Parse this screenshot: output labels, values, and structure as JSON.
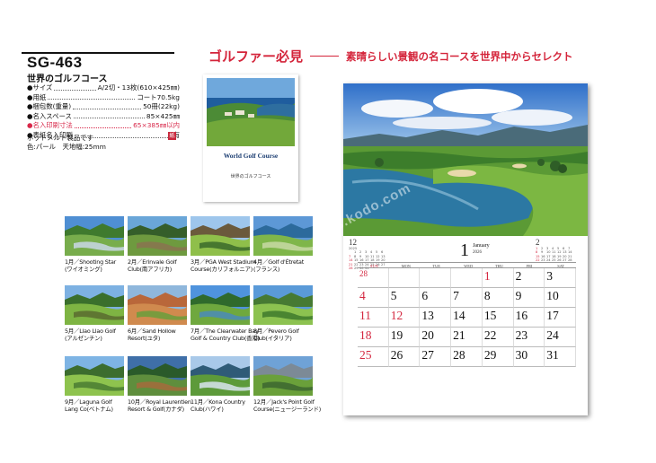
{
  "product": {
    "model": "SG-463",
    "title": "世界のゴルフコース",
    "specs": [
      {
        "key": "●サイズ",
        "value": "A/2切・13枚(610×425㎜)",
        "highlight": false
      },
      {
        "key": "●用紙",
        "value": "コート70.5kg",
        "highlight": false
      },
      {
        "key": "●梱包数(重量)",
        "value": "50冊(22kg)",
        "highlight": false
      },
      {
        "key": "●名入スペース",
        "value": "85×425㎜",
        "highlight": false
      },
      {
        "key": "●名入印刷寸法",
        "value": "65×385㎜以内",
        "highlight": true
      },
      {
        "key": "●表紙名入印刷",
        "value": "有",
        "highlight": false
      }
    ],
    "note_line1": "ホットメルト製品です",
    "note_line2": "色:パール　天地幅:25mm",
    "badge": "紙"
  },
  "headline": {
    "lead": "ゴルファー必見",
    "tagline": "素晴らしい景観の名コースを世界中からセレクト",
    "accent_color": "#d4243a"
  },
  "cover": {
    "title": "World Golf Course",
    "subtitle": "世界のゴルフコース"
  },
  "months": [
    {
      "line1": "1月／Shooting Star",
      "line2": "(ワイオミング)"
    },
    {
      "line1": "2月／Erinvale Golf",
      "line2": "Club(南アフリカ)"
    },
    {
      "line1": "3月／PGA West Stadium",
      "line2": "Course(カリフォルニア)"
    },
    {
      "line1": "4月／Golf d'Étretat",
      "line2": "(フランス)"
    },
    {
      "line1": "5月／Llao Llao Golf",
      "line2": "(アルゼンチン)"
    },
    {
      "line1": "6月／Sand Hollow",
      "line2": "Resort(ユタ)"
    },
    {
      "line1": "7月／The Clearwater Bay",
      "line2": "Golf & Country Club(香港)"
    },
    {
      "line1": "8月／Pevero Golf",
      "line2": "Club(イタリア)"
    },
    {
      "line1": "9月／Laguna Golf",
      "line2": "Lang Co(ベトナム)"
    },
    {
      "line1": "10月／Royal Laurentien",
      "line2": "Resort & Golf(カナダ)"
    },
    {
      "line1": "11月／Kona Country",
      "line2": "Club(ハワイ)"
    },
    {
      "line1": "12月／Jack's Point Golf",
      "line2": "Course(ニュージーランド)"
    }
  ],
  "watermark": "s.kodo.com",
  "calendar": {
    "month_num": "1",
    "month_name": "January",
    "year": "2026",
    "weekdays": [
      "SUN",
      "MON",
      "TUE",
      "WED",
      "THU",
      "FRI",
      "SAT"
    ],
    "prev_month": {
      "num": "12",
      "year": "2025",
      "start": 1,
      "days": 31
    },
    "next_month": {
      "num": "2",
      "year": "",
      "start": 0,
      "days": 28
    },
    "leading_day": "28",
    "weeks": [
      [
        "",
        "",
        "",
        "",
        "1",
        "2",
        "3"
      ],
      [
        "4",
        "5",
        "6",
        "7",
        "8",
        "9",
        "10"
      ],
      [
        "11",
        "12",
        "13",
        "14",
        "15",
        "16",
        "17"
      ],
      [
        "18",
        "19",
        "20",
        "21",
        "22",
        "23",
        "24"
      ],
      [
        "25",
        "26",
        "27",
        "28",
        "29",
        "30",
        "31"
      ]
    ],
    "holidays": [
      "1",
      "12"
    ]
  }
}
